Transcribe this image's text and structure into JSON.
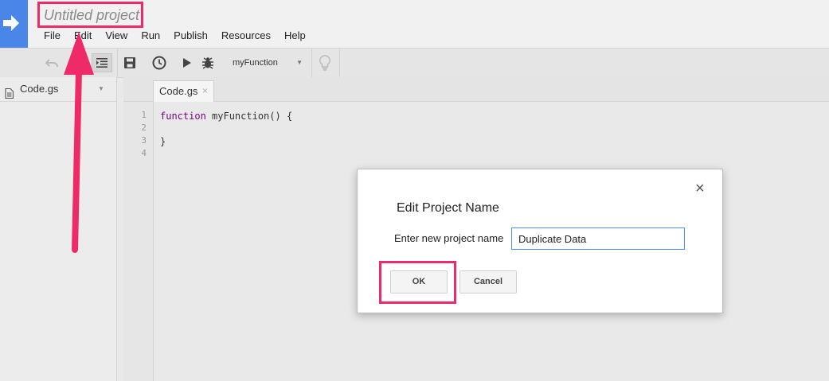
{
  "project": {
    "title": "Untitled project"
  },
  "menu": [
    "File",
    "Edit",
    "View",
    "Run",
    "Publish",
    "Resources",
    "Help"
  ],
  "toolbar": {
    "function_select": "myFunction",
    "icons": [
      "undo-icon",
      "redo-icon",
      "indent-icon",
      "save-icon",
      "triggers-clock-icon",
      "run-icon",
      "debug-bug-icon",
      "lightbulb-icon"
    ]
  },
  "sidebar": {
    "file_name": "Code.gs"
  },
  "editor": {
    "tab_label": "Code.gs",
    "line_numbers": [
      "1",
      "2",
      "3",
      "4"
    ],
    "code_keyword": "function",
    "code_line1_rest": " myFunction() {",
    "code_line3": "}"
  },
  "dialog": {
    "title": "Edit Project Name",
    "close_glyph": "×",
    "label": "Enter new project name",
    "input_value": "Duplicate Data",
    "ok_label": "OK",
    "cancel_label": "Cancel"
  },
  "annotation": {
    "color": "#ee2a68"
  }
}
